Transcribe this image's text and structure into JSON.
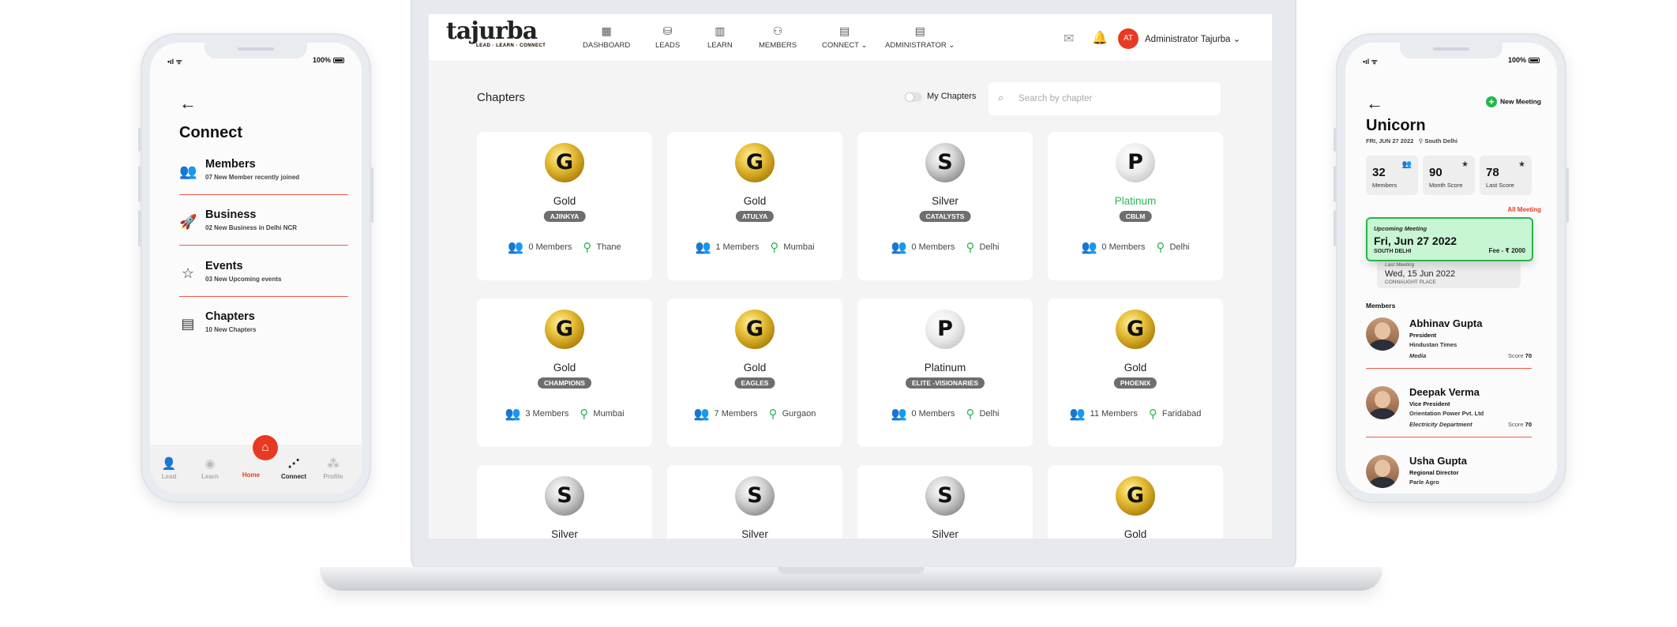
{
  "left_phone": {
    "status": {
      "signal": "•ıl ᯤ",
      "battery": "100%"
    },
    "title": "Connect",
    "menu": [
      {
        "title": "Members",
        "sub": "07 New Member recently joined",
        "icon": "members-icon"
      },
      {
        "title": "Business",
        "sub": "02 New Business in Delhi NCR",
        "icon": "rocket-icon"
      },
      {
        "title": "Events",
        "sub": "03 New Upcoming events",
        "icon": "calendar-icon"
      },
      {
        "title": "Chapters",
        "sub": "10 New Chapters",
        "icon": "document-icon"
      }
    ],
    "tabs": [
      {
        "label": "Lead",
        "icon": "lead-icon"
      },
      {
        "label": "Learn",
        "icon": "learn-icon"
      },
      {
        "label": "Home",
        "icon": "home-icon"
      },
      {
        "label": "Connect",
        "icon": "share-icon"
      },
      {
        "label": "Profile",
        "icon": "profile-icon"
      }
    ]
  },
  "laptop": {
    "logo": {
      "text": "tajurba",
      "tagline": "LEAD · LEARN · CONNECT"
    },
    "nav": [
      {
        "label": "DASHBOARD",
        "icon": "dashboard-icon"
      },
      {
        "label": "LEADS",
        "icon": "database-icon"
      },
      {
        "label": "LEARN",
        "icon": "book-icon"
      },
      {
        "label": "MEMBERS",
        "icon": "users-icon"
      },
      {
        "label": "CONNECT",
        "icon": "connect-icon"
      },
      {
        "label": "ADMINISTRATOR",
        "icon": "admin-icon"
      }
    ],
    "user": {
      "initials": "AT",
      "name": "Administrator Tajurba"
    },
    "page_title": "Chapters",
    "toggle_label": "My Chapters",
    "search_placeholder": "Search by chapter",
    "chapters": [
      {
        "letter": "G",
        "tier": "Gold",
        "name": "AJINKYA",
        "members": "0 Members",
        "city": "Thane"
      },
      {
        "letter": "G",
        "tier": "Gold",
        "name": "ATULYA",
        "members": "1 Members",
        "city": "Mumbai"
      },
      {
        "letter": "S",
        "tier": "Silver",
        "name": "CATALYSTS",
        "members": "0 Members",
        "city": "Delhi"
      },
      {
        "letter": "P",
        "tier": "Platinum",
        "name": "CBLM",
        "members": "0 Members",
        "city": "Delhi"
      },
      {
        "letter": "G",
        "tier": "Gold",
        "name": "CHAMPIONS",
        "members": "3 Members",
        "city": "Mumbai"
      },
      {
        "letter": "G",
        "tier": "Gold",
        "name": "EAGLES",
        "members": "7 Members",
        "city": "Gurgaon"
      },
      {
        "letter": "P",
        "tier": "Platinum",
        "name": "ELITE -VISIONARIES",
        "members": "0 Members",
        "city": "Delhi"
      },
      {
        "letter": "G",
        "tier": "Gold",
        "name": "PHOENIX",
        "members": "11 Members",
        "city": "Faridabad"
      },
      {
        "letter": "S",
        "tier": "Silver",
        "name": "",
        "members": "",
        "city": ""
      },
      {
        "letter": "S",
        "tier": "Silver",
        "name": "",
        "members": "",
        "city": ""
      },
      {
        "letter": "S",
        "tier": "Silver",
        "name": "",
        "members": "",
        "city": ""
      },
      {
        "letter": "G",
        "tier": "Gold",
        "name": "",
        "members": "",
        "city": ""
      }
    ]
  },
  "right_phone": {
    "status": {
      "signal": "•ıl ᯤ",
      "battery": "100%"
    },
    "new_meeting": "New Meeting",
    "title": "Unicorn",
    "date": "FRI, JUN 27 2022",
    "location": "South Delhi",
    "stats": [
      {
        "value": "32",
        "label": "Members",
        "icon": "members-icon"
      },
      {
        "value": "90",
        "label": "Month Score",
        "icon": "star-icon"
      },
      {
        "value": "78",
        "label": "Last Score",
        "icon": "star-icon"
      }
    ],
    "all_meeting": "All Meeting",
    "upcoming": {
      "label": "Upcoming Meeting",
      "date": "Fri, Jun 27 2022",
      "place": "SOUTH DELHI",
      "fee": "Fee - ₹ 2000"
    },
    "last": {
      "label": "Last Meeting",
      "date": "Wed, 15 Jun 2022",
      "place": "CONNAUGHT PLACE"
    },
    "members_heading": "Members",
    "members": [
      {
        "name": "Abhinav Gupta",
        "role": "President",
        "company": "Hindustan Times",
        "category": "Media",
        "score_label": "Score",
        "score": "70"
      },
      {
        "name": "Deepak Verma",
        "role": "Vice President",
        "company": "Orientation Power Pvt. Ltd",
        "category": "Electricity Department",
        "score_label": "Score",
        "score": "70"
      },
      {
        "name": "Usha Gupta",
        "role": "Regional Director",
        "company": "Parle Agro",
        "category": "",
        "score_label": "",
        "score": ""
      }
    ]
  }
}
